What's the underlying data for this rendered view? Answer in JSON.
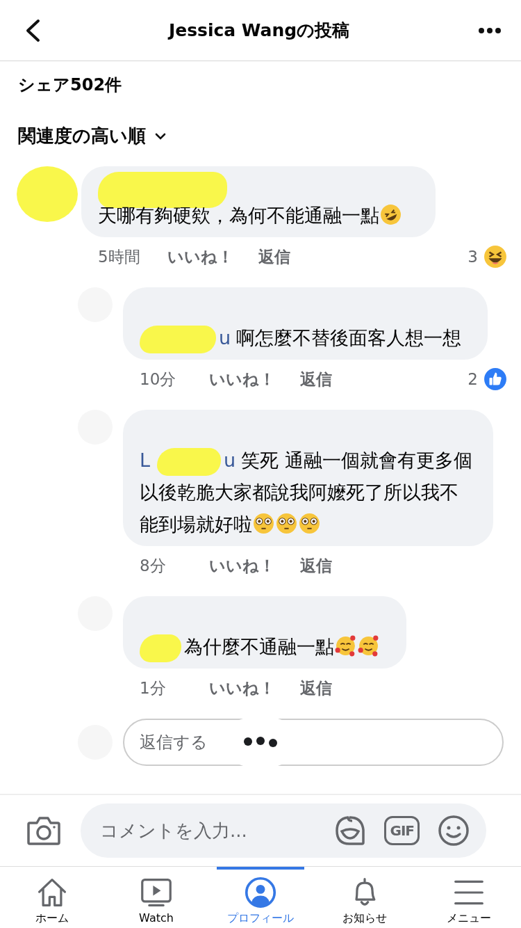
{
  "header": {
    "title": "Jessica Wangの投稿"
  },
  "shares": "シェア502件",
  "sort": {
    "label": "関連度の高い順"
  },
  "comments": [
    {
      "text": "天哪有夠硬欸，為何不能通融一點",
      "emoji": [
        {
          "kind": "rofl"
        }
      ],
      "time": "5時間",
      "like": "いいね！",
      "reply": "返信",
      "reaction": {
        "count": "3",
        "kind": "laugh"
      },
      "replies": [
        {
          "name_end": "u",
          "text": "啊怎麼不替後面客人想一想",
          "time": "10分",
          "like": "いいね！",
          "reply": "返信",
          "reaction": {
            "count": "2",
            "kind": "like"
          }
        },
        {
          "name_start": "L",
          "name_end": "u",
          "text": "笑死 通融一個就會有更多個",
          "text_more": [
            "以後乾脆大家都說我阿嬤死了所以我不",
            "能到場就好啦"
          ],
          "emoji": [
            {
              "kind": "flushed"
            },
            {
              "kind": "flushed"
            },
            {
              "kind": "flushed"
            }
          ],
          "time": "8分",
          "like": "いいね！",
          "reply": "返信"
        },
        {
          "text": "為什麼不通融一點",
          "emoji": [
            {
              "kind": "hearts"
            },
            {
              "kind": "hearts"
            }
          ],
          "time": "1分",
          "like": "いいね！",
          "reply": "返信"
        }
      ],
      "reply_field": {
        "placeholder": "返信する"
      }
    }
  ],
  "composer": {
    "placeholder": "コメントを入力...",
    "gif": "GIF"
  },
  "tabs": [
    {
      "kind": "home",
      "label": "ホーム",
      "selected": false
    },
    {
      "kind": "watch",
      "label": "Watch",
      "selected": false
    },
    {
      "kind": "profile",
      "label": "プロフィール",
      "selected": true
    },
    {
      "kind": "bell",
      "label": "お知らせ",
      "selected": false
    },
    {
      "kind": "menu",
      "label": "メニュー",
      "selected": false
    }
  ]
}
